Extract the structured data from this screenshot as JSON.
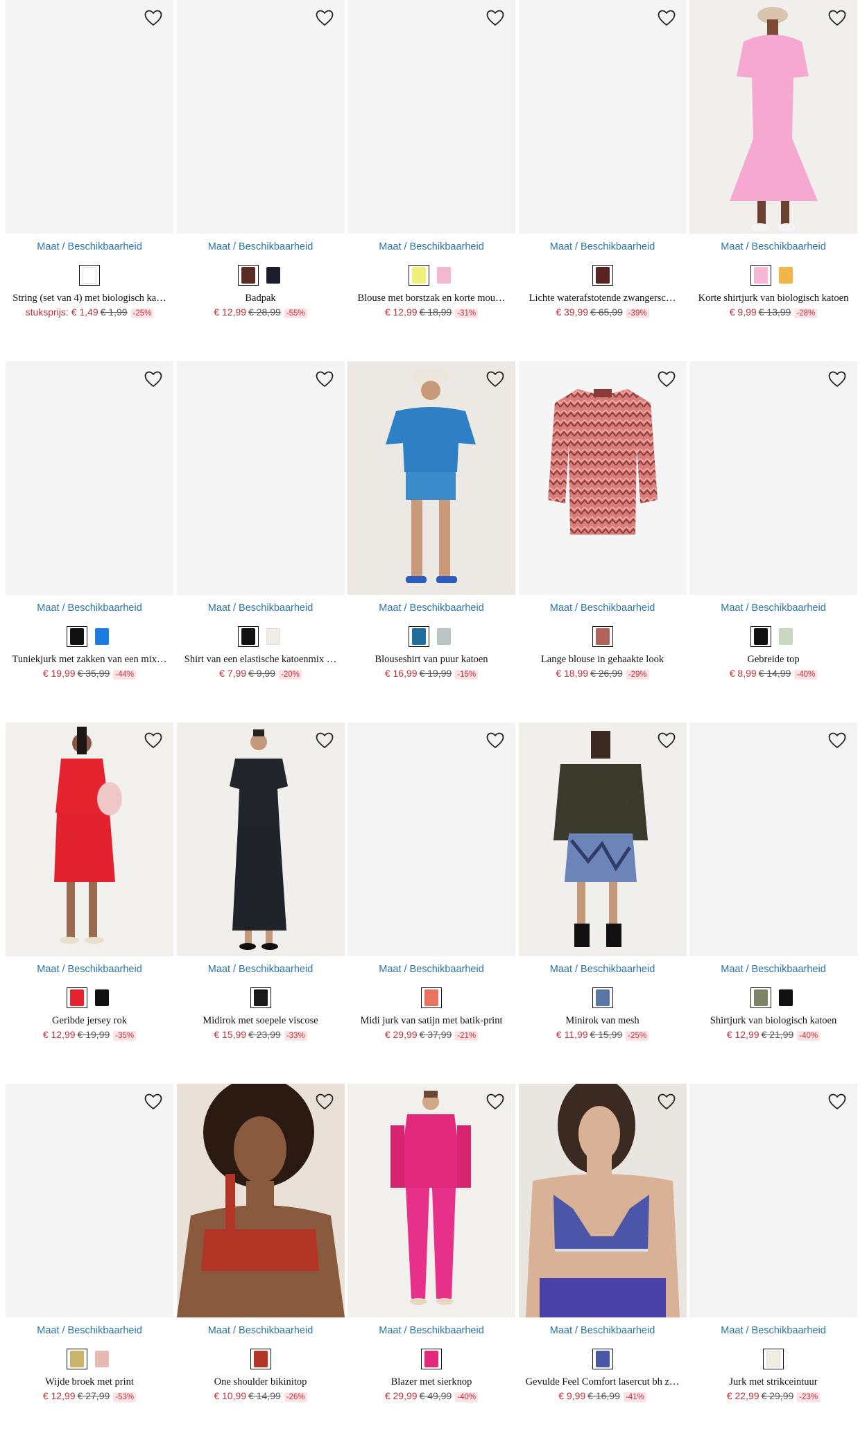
{
  "products": [
    {
      "availability": "Maat / Beschikbaarheid",
      "name": "String (set van 4) met biologisch ka…",
      "price_prefix": "stuksprijs: ",
      "price": "€ 1,49",
      "old_price": "€ 1,99",
      "discount": "-25%",
      "photo": "none",
      "swatches": [
        {
          "color": "#ffffff",
          "selected": true,
          "icon": "garment-icon"
        }
      ]
    },
    {
      "availability": "Maat / Beschikbaarheid",
      "name": "Badpak",
      "price_prefix": "",
      "price": "€ 12,99",
      "old_price": "€ 28,99",
      "discount": "-55%",
      "photo": "none",
      "swatches": [
        {
          "color": "#5a2b22",
          "selected": true
        },
        {
          "color": "#1c1d2a",
          "selected": false
        }
      ]
    },
    {
      "availability": "Maat / Beschikbaarheid",
      "name": "Blouse met borstzak en korte mou…",
      "price_prefix": "",
      "price": "€ 12,99",
      "old_price": "€ 18,99",
      "discount": "-31%",
      "photo": "none",
      "swatches": [
        {
          "color": "#eef07a",
          "selected": true
        },
        {
          "color": "#f2b8cf",
          "selected": false
        }
      ]
    },
    {
      "availability": "Maat / Beschikbaarheid",
      "name": "Lichte waterafstotende zwangersc…",
      "price_prefix": "",
      "price": "€ 39,99",
      "old_price": "€ 65,99",
      "discount": "-39%",
      "photo": "none",
      "swatches": [
        {
          "color": "#5a2520",
          "selected": true
        }
      ]
    },
    {
      "availability": "Maat / Beschikbaarheid",
      "name": "Korte shirtjurk van biologisch katoen",
      "price_prefix": "",
      "price": "€ 9,99",
      "old_price": "€ 13,99",
      "discount": "-28%",
      "photo": "pink-dress",
      "swatches": [
        {
          "color": "#f7b6d6",
          "selected": true
        },
        {
          "color": "#f2b54a",
          "selected": false
        }
      ]
    },
    {
      "availability": "Maat / Beschikbaarheid",
      "name": "Tuniekjurk met zakken van een mix…",
      "price_prefix": "",
      "price": "€ 19,99",
      "old_price": "€ 35,99",
      "discount": "-44%",
      "photo": "none",
      "swatches": [
        {
          "color": "#111111",
          "selected": true
        },
        {
          "color": "#1a7be0",
          "selected": false
        }
      ]
    },
    {
      "availability": "Maat / Beschikbaarheid",
      "name": "Shirt van een elastische katoenmix …",
      "price_prefix": "",
      "price": "€ 7,99",
      "old_price": "€ 9,99",
      "discount": "-20%",
      "photo": "none",
      "swatches": [
        {
          "color": "#111111",
          "selected": true
        },
        {
          "color": "#f0ede6",
          "selected": false
        }
      ]
    },
    {
      "availability": "Maat / Beschikbaarheid",
      "name": "Blouseshirt van puur katoen",
      "price_prefix": "",
      "price": "€ 16,99",
      "old_price": "€ 19,99",
      "discount": "-15%",
      "photo": "blue-outfit",
      "swatches": [
        {
          "color": "#1e6f9e",
          "selected": true
        },
        {
          "color": "#b9c4c4",
          "selected": false
        }
      ]
    },
    {
      "availability": "Maat / Beschikbaarheid",
      "name": "Lange blouse in gehaakte look",
      "price_prefix": "",
      "price": "€ 18,99",
      "old_price": "€ 26,99",
      "discount": "-29%",
      "photo": "zigzag-blouse",
      "swatches": [
        {
          "color": "#b0635d",
          "selected": true
        }
      ]
    },
    {
      "availability": "Maat / Beschikbaarheid",
      "name": "Gebreide top",
      "price_prefix": "",
      "price": "€ 8,99",
      "old_price": "€ 14,99",
      "discount": "-40%",
      "photo": "none",
      "swatches": [
        {
          "color": "#111111",
          "selected": true
        },
        {
          "color": "#c8d8c0",
          "selected": false
        }
      ]
    },
    {
      "availability": "Maat / Beschikbaarheid",
      "name": "Geribde jersey rok",
      "price_prefix": "",
      "price": "€ 12,99",
      "old_price": "€ 19,99",
      "discount": "-35%",
      "photo": "red-skirt",
      "swatches": [
        {
          "color": "#e52430",
          "selected": true
        },
        {
          "color": "#111111",
          "selected": false
        }
      ]
    },
    {
      "availability": "Maat / Beschikbaarheid",
      "name": "Midirok met soepele viscose",
      "price_prefix": "",
      "price": "€ 15,99",
      "old_price": "€ 23,99",
      "discount": "-33%",
      "photo": "black-dress",
      "swatches": [
        {
          "color": "#1a1a1a",
          "selected": true
        }
      ]
    },
    {
      "availability": "Maat / Beschikbaarheid",
      "name": "Midi jurk van satijn met batik-print",
      "price_prefix": "",
      "price": "€ 29,99",
      "old_price": "€ 37,99",
      "discount": "-21%",
      "photo": "none",
      "swatches": [
        {
          "color": "#e9735e",
          "selected": true
        }
      ]
    },
    {
      "availability": "Maat / Beschikbaarheid",
      "name": "Minirok van mesh",
      "price_prefix": "",
      "price": "€ 11,99",
      "old_price": "€ 15,99",
      "discount": "-25%",
      "photo": "mesh-skirt",
      "swatches": [
        {
          "color": "#5a75a8",
          "selected": true
        }
      ]
    },
    {
      "availability": "Maat / Beschikbaarheid",
      "name": "Shirtjurk van biologisch katoen",
      "price_prefix": "",
      "price": "€ 12,99",
      "old_price": "€ 21,99",
      "discount": "-40%",
      "photo": "none",
      "swatches": [
        {
          "color": "#7d8466",
          "selected": true
        },
        {
          "color": "#111111",
          "selected": false
        }
      ]
    },
    {
      "availability": "Maat / Beschikbaarheid",
      "name": "Wijde broek met print",
      "price_prefix": "",
      "price": "€ 12,99",
      "old_price": "€ 27,99",
      "discount": "-53%",
      "photo": "none",
      "swatches": [
        {
          "color": "#c9b46a",
          "selected": true
        },
        {
          "color": "#e7b9b3",
          "selected": false
        }
      ]
    },
    {
      "availability": "Maat / Beschikbaarheid",
      "name": "One shoulder bikinitop",
      "price_prefix": "",
      "price": "€ 10,99",
      "old_price": "€ 14,99",
      "discount": "-26%",
      "photo": "bikini",
      "swatches": [
        {
          "color": "#b13424",
          "selected": true
        }
      ]
    },
    {
      "availability": "Maat / Beschikbaarheid",
      "name": "Blazer met sierknop",
      "price_prefix": "",
      "price": "€ 29,99",
      "old_price": "€ 49,99",
      "discount": "-40%",
      "photo": "pink-suit",
      "swatches": [
        {
          "color": "#e1287a",
          "selected": true
        }
      ]
    },
    {
      "availability": "Maat / Beschikbaarheid",
      "name": "Gevulde Feel Comfort lasercut bh z…",
      "price_prefix": "",
      "price": "€ 9,99",
      "old_price": "€ 16,99",
      "discount": "-41%",
      "photo": "bra",
      "swatches": [
        {
          "color": "#4c56a8",
          "selected": true
        }
      ]
    },
    {
      "availability": "Maat / Beschikbaarheid",
      "name": "Jurk met strikceintuur",
      "price_prefix": "",
      "price": "€ 22,99",
      "old_price": "€ 29,99",
      "discount": "-23%",
      "photo": "none",
      "swatches": [
        {
          "color": "#f1ece0",
          "selected": true
        }
      ]
    }
  ]
}
